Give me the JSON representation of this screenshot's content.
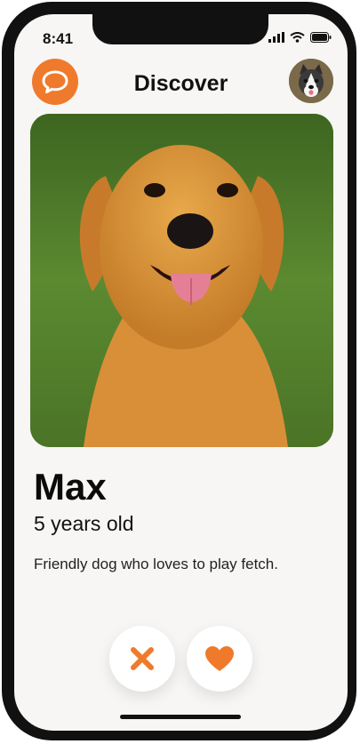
{
  "status_bar": {
    "time": "8:41"
  },
  "header": {
    "title": "Discover"
  },
  "profile": {
    "name": "Max",
    "age": "5 years old",
    "bio": "Friendly dog who loves to play fetch."
  },
  "icons": {
    "chat": "chat-bubble-icon",
    "pass": "x-icon",
    "like": "heart-icon",
    "signal": "signal-icon",
    "wifi": "wifi-icon",
    "battery": "battery-icon"
  },
  "colors": {
    "accent": "#f07a2b",
    "background": "#f7f6f4",
    "text": "#111111"
  }
}
